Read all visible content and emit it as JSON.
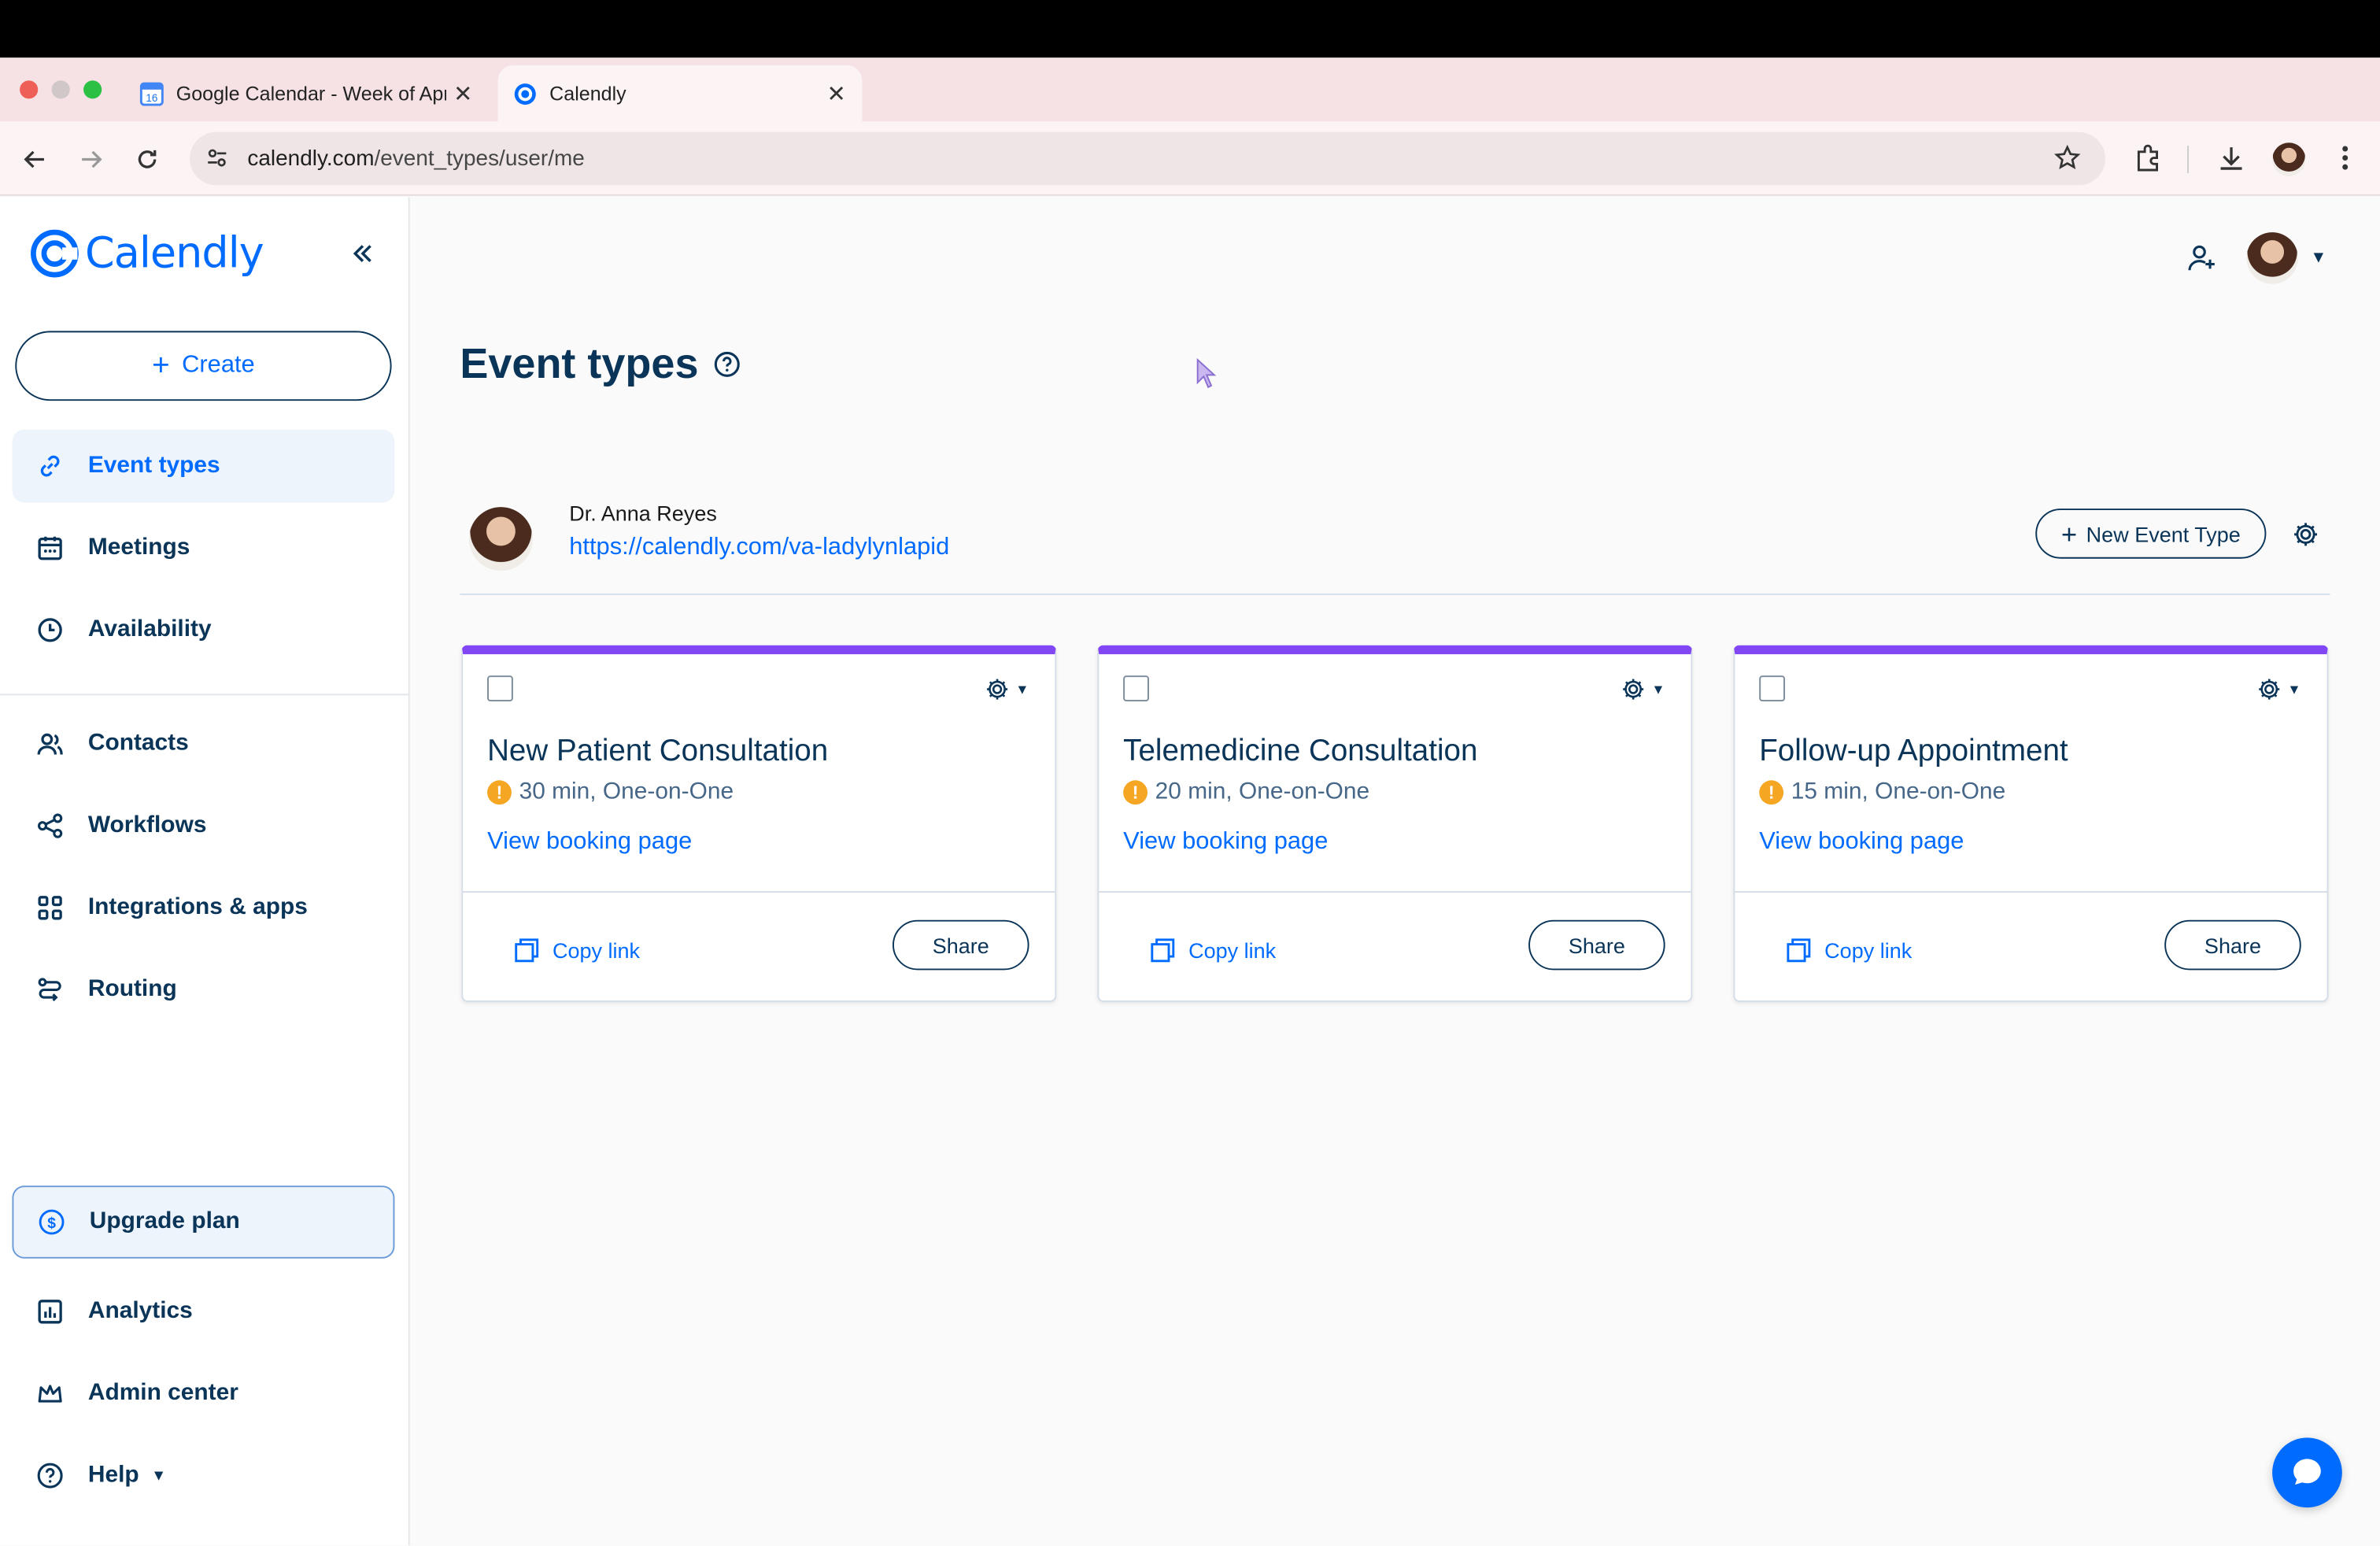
{
  "browser": {
    "tabs": [
      {
        "title": "Google Calendar - Week of April",
        "favicon": "google-calendar-icon",
        "active": false
      },
      {
        "title": "Calendly",
        "favicon": "calendly-icon",
        "active": true
      }
    ],
    "calendar_favicon_day": "16",
    "url_host": "calendly.com",
    "url_path": "/event_types/user/me"
  },
  "sidebar": {
    "logo_text": "Calendly",
    "create_label": "Create",
    "items": [
      {
        "label": "Event types",
        "icon": "link-icon",
        "active": true
      },
      {
        "label": "Meetings",
        "icon": "calendar-icon"
      },
      {
        "label": "Availability",
        "icon": "clock-icon"
      },
      {
        "label": "Contacts",
        "icon": "contacts-icon"
      },
      {
        "label": "Workflows",
        "icon": "workflows-icon"
      },
      {
        "label": "Integrations & apps",
        "icon": "grid-icon"
      },
      {
        "label": "Routing",
        "icon": "routing-icon"
      },
      {
        "label": "Upgrade plan",
        "icon": "dollar-icon"
      },
      {
        "label": "Analytics",
        "icon": "analytics-icon"
      },
      {
        "label": "Admin center",
        "icon": "crown-icon"
      },
      {
        "label": "Help",
        "icon": "help-icon"
      }
    ]
  },
  "main": {
    "title": "Event types",
    "user": {
      "name": "Dr. Anna Reyes",
      "link": "https://calendly.com/va-ladylynlapid"
    },
    "new_event_label": "New Event Type",
    "cards": [
      {
        "title": "New Patient Consultation",
        "duration": "30 min, One-on-One",
        "view_label": "View booking page",
        "copy_label": "Copy link",
        "share_label": "Share"
      },
      {
        "title": "Telemedicine Consultation",
        "duration": "20 min, One-on-One",
        "view_label": "View booking page",
        "copy_label": "Copy link",
        "share_label": "Share"
      },
      {
        "title": "Follow-up Appointment",
        "duration": "15 min, One-on-One",
        "view_label": "View booking page",
        "copy_label": "Copy link",
        "share_label": "Share"
      }
    ]
  },
  "colors": {
    "accent": "#006bff",
    "navy": "#0b3558",
    "card_top": "#8247f5",
    "warning": "#f5a623"
  }
}
